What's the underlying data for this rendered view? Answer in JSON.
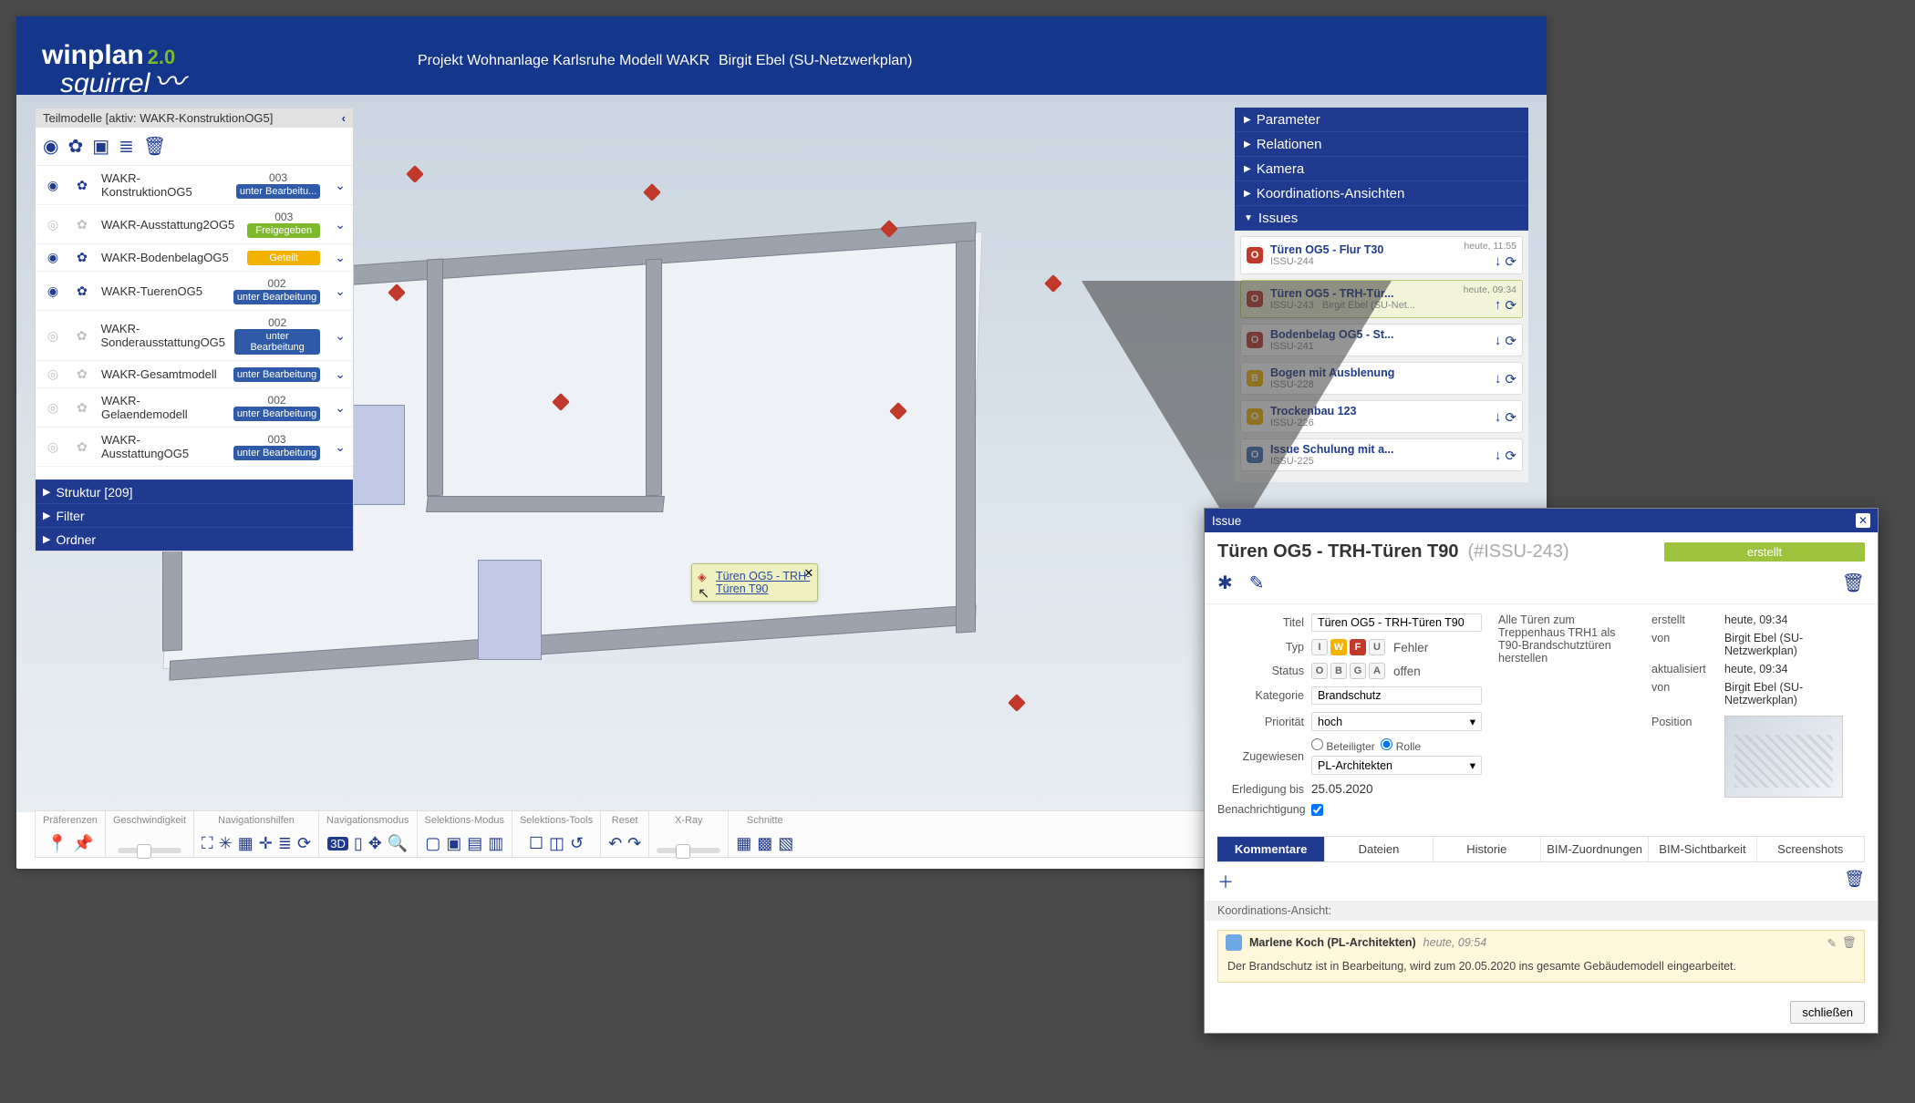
{
  "brand": {
    "name1": "winplan",
    "ver": "2.0",
    "name2": "squirrel"
  },
  "header": {
    "project": "Projekt Wohnanlage Karlsruhe Modell WAKR",
    "user": "Birgit Ebel (SU-Netzwerkplan)"
  },
  "left": {
    "title": "Teilmodelle [aktiv: WAKR-KonstruktionOG5]",
    "rows": [
      {
        "name": "WAKR-KonstruktionOG5",
        "ver": "003",
        "status": "unter Bearbeitu...",
        "cls": "st-blue",
        "eye": true
      },
      {
        "name": "WAKR-Ausstattung2OG5",
        "ver": "003",
        "status": "Freigegeben",
        "cls": "st-green",
        "eye": false
      },
      {
        "name": "WAKR-BodenbelagOG5",
        "ver": "",
        "status": "Geteilt",
        "cls": "st-yellow",
        "eye": true
      },
      {
        "name": "WAKR-TuerenOG5",
        "ver": "002",
        "status": "unter Bearbeitung",
        "cls": "st-blue",
        "eye": true
      },
      {
        "name": "WAKR-SonderausstattungOG5",
        "ver": "002",
        "status": "unter Bearbeitung",
        "cls": "st-blue",
        "eye": false
      },
      {
        "name": "WAKR-Gesamtmodell",
        "ver": "",
        "status": "unter Bearbeitung",
        "cls": "st-blue",
        "eye": false
      },
      {
        "name": "WAKR-Gelaendemodell",
        "ver": "002",
        "status": "unter Bearbeitung",
        "cls": "st-blue",
        "eye": false
      },
      {
        "name": "WAKR-AusstattungOG5",
        "ver": "003",
        "status": "unter Bearbeitung",
        "cls": "st-blue",
        "eye": false
      }
    ],
    "sections": {
      "struktur": "Struktur [209]",
      "filter": "Filter",
      "ordner": "Ordner"
    }
  },
  "right": {
    "acc": [
      "Parameter",
      "Relationen",
      "Kamera",
      "Koordinations-Ansichten",
      "Issues"
    ],
    "issues": [
      {
        "badge": "O",
        "bcls": "b-red",
        "title": "Türen OG5 - Flur T30",
        "id": "ISSU-244",
        "ts": "heute, 11:55"
      },
      {
        "badge": "O",
        "bcls": "b-red",
        "title": "Türen OG5 - TRH-Tür...",
        "id": "ISSU-243",
        "ts": "heute, 09:34",
        "sub": "Birgit Ebel (SU-Net...",
        "active": true
      },
      {
        "badge": "O",
        "bcls": "b-red",
        "title": "Bodenbelag OG5 - St...",
        "id": "ISSU-241",
        "ts": ""
      },
      {
        "badge": "B",
        "bcls": "b-yellow",
        "title": "Bogen mit Ausblenung",
        "id": "ISSU-228",
        "ts": ""
      },
      {
        "badge": "O",
        "bcls": "b-yellow",
        "title": "Trockenbau 123",
        "id": "ISSU-226",
        "ts": ""
      },
      {
        "badge": "O",
        "bcls": "b-blue",
        "title": "Issue Schulung mit a...",
        "id": "ISSU-225",
        "ts": ""
      }
    ]
  },
  "tooltip": {
    "line1": "Türen OG5 - TRH-",
    "line2": "Türen T90"
  },
  "toolbar": {
    "groups": [
      "Präferenzen",
      "Geschwindigkeit",
      "Navigationshilfen",
      "Navigationsmodus",
      "Selektions-Modus",
      "Selektions-Tools",
      "Reset",
      "X-Ray",
      "Schnitte"
    ]
  },
  "issue": {
    "panel": "Issue",
    "title": "Türen OG5 - TRH-Türen T90",
    "id": "(#ISSU-243)",
    "state": "erstellt",
    "labels": {
      "titel": "Titel",
      "typ": "Typ",
      "status": "Status",
      "kategorie": "Kategorie",
      "prio": "Priorität",
      "zugewiesen": "Zugewiesen",
      "erledigung": "Erledigung bis",
      "benachrichtigung": "Benachrichtigung",
      "erstellt": "erstellt",
      "von": "von",
      "aktualisiert": "aktualisiert",
      "position": "Position",
      "beteiligter": "Beteiligter",
      "rolle": "Rolle"
    },
    "values": {
      "titel": "Türen OG5 - TRH-Türen T90",
      "typ_text": "Fehler",
      "status_text": "offen",
      "kategorie": "Brandschutz",
      "prio": "hoch",
      "zugewiesen": "PL-Architekten",
      "erledigung": "25.05.2020",
      "desc": "Alle Türen zum Treppenhaus TRH1 als T90-Brandschutztüren herstellen",
      "erstellt_ts": "heute, 09:34",
      "erstellt_von": "Birgit Ebel (SU-Netzwerkplan)",
      "akt_ts": "heute, 09:34",
      "akt_von": "Birgit Ebel (SU-Netzwerkplan)"
    },
    "tabs": [
      "Kommentare",
      "Dateien",
      "Historie",
      "BIM-Zuordnungen",
      "BIM-Sichtbarkeit",
      "Screenshots"
    ],
    "koord": "Koordinations-Ansicht:",
    "comment": {
      "author": "Marlene Koch (PL-Architekten)",
      "ts": "heute, 09:54",
      "body": "Der Brandschutz ist in Bearbeitung, wird zum 20.05.2020 ins gesamte Gebäudemodell eingearbeitet."
    },
    "close": "schließen"
  }
}
